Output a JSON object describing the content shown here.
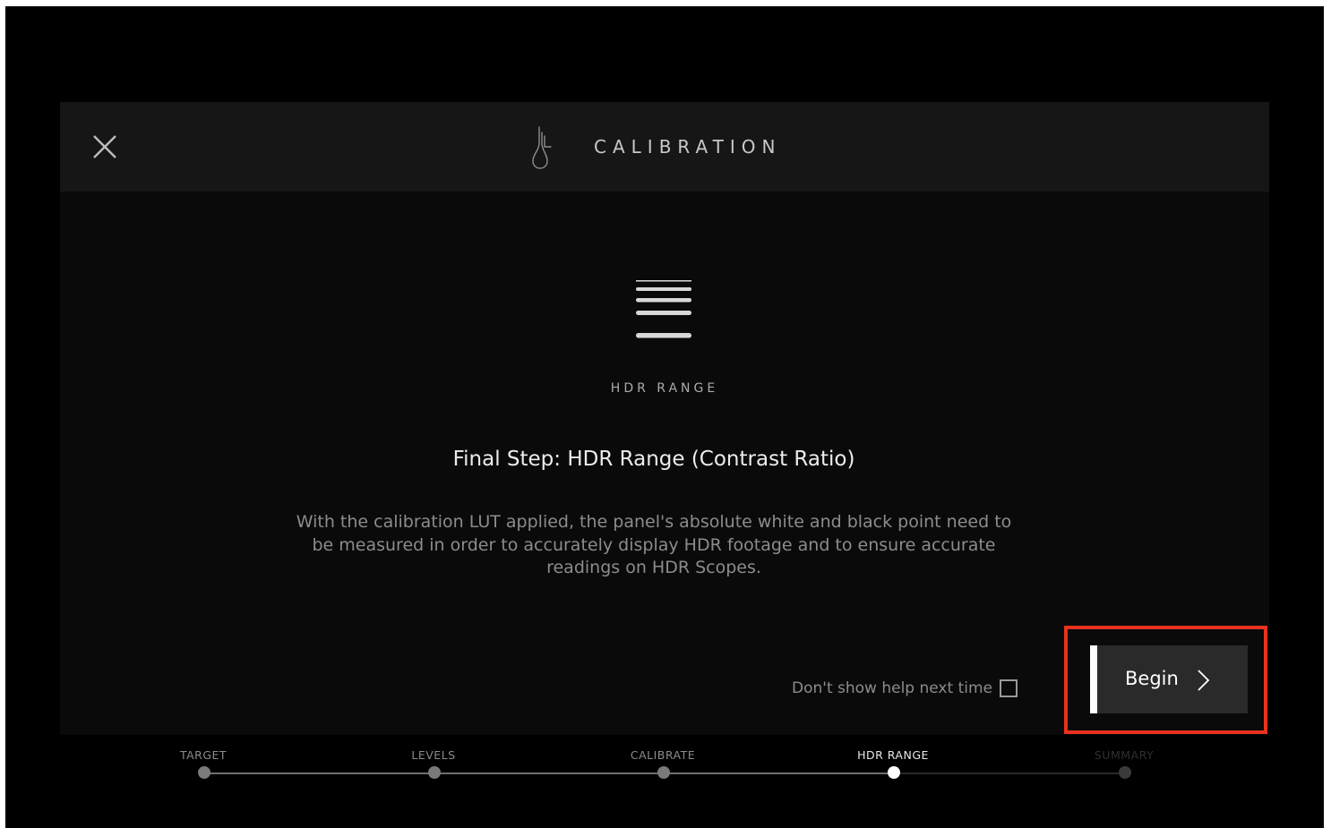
{
  "header": {
    "title": "CALIBRATION",
    "logo_icon": "tuning-fork-icon",
    "close_icon": "close-icon"
  },
  "step": {
    "icon": "hdr-range-icon",
    "label": "HDR RANGE",
    "heading": "Final Step: HDR Range (Contrast Ratio)",
    "description": "With the calibration LUT applied, the panel's absolute white and black point need to be measured in order to accurately display HDR footage and to ensure accurate readings on HDR Scopes."
  },
  "footer": {
    "dont_show_label": "Don't show help next time",
    "dont_show_checked": false,
    "begin_label": "Begin",
    "begin_icon": "chevron-right-icon"
  },
  "progress": {
    "steps": [
      {
        "label": "TARGET",
        "state": "done"
      },
      {
        "label": "LEVELS",
        "state": "done"
      },
      {
        "label": "CALIBRATE",
        "state": "done"
      },
      {
        "label": "HDR RANGE",
        "state": "current"
      },
      {
        "label": "SUMMARY",
        "state": "upcoming"
      }
    ]
  },
  "colors": {
    "background": "#000000",
    "panel": "#0a0a0a",
    "header": "#161616",
    "highlight": "#e8321e",
    "button": "#2a2a2a"
  }
}
